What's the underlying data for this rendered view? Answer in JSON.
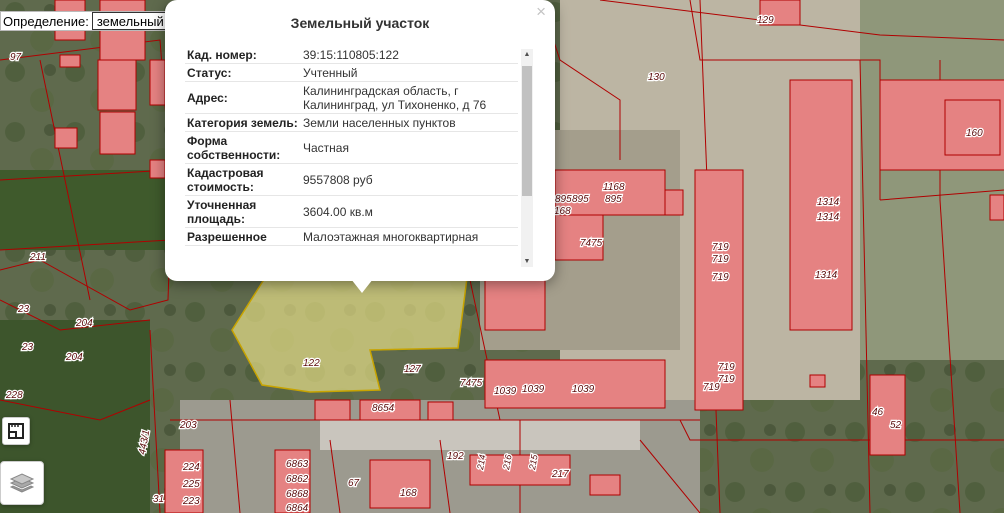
{
  "definition": {
    "label": "Определение:",
    "selected": "земельный участок"
  },
  "popup": {
    "title": "Земельный участок",
    "close": "×",
    "fields": [
      {
        "key": "Кад. номер:",
        "value": "39:15:110805:122"
      },
      {
        "key": "Статус:",
        "value": "Учтенный"
      },
      {
        "key": "Адрес:",
        "value": "Калининградская область, г Калининград, ул Тихоненко, д 76"
      },
      {
        "key": "Категория земель:",
        "value": "Земли населенных пунктов"
      },
      {
        "key": "Форма собственности:",
        "value": "Частная"
      },
      {
        "key": "Кадастровая стоимость:",
        "value": "9557808 руб"
      },
      {
        "key": "Уточненная площадь:",
        "value": "3604.00 кв.м"
      },
      {
        "key": "Разрешенное",
        "value": "Малоэтажная многоквартирная"
      }
    ]
  },
  "map_labels": {
    "l97": "97",
    "l129": "129",
    "l130": "130",
    "l160": "160",
    "l1168": "1168",
    "l895": "895",
    "l895b": "895",
    "l895c": "895",
    "l168": "168",
    "l7475": "7475",
    "l7475b": "7475",
    "l719a": "719",
    "l719b": "719",
    "l719c": "719",
    "l719d": "719",
    "l719e": "719",
    "l719f": "719",
    "l1314a": "1314",
    "l1314b": "1314",
    "l1314c": "1314",
    "l211": "211",
    "l23a": "23",
    "l23b": "23",
    "l204a": "204",
    "l204b": "204",
    "l228": "228",
    "l122": "122",
    "l127": "127",
    "l1039a": "1039",
    "l1039b": "1039",
    "l1039c": "1039",
    "l8654": "8654",
    "l46": "46",
    "l52": "52",
    "l203": "203",
    "l4431": "443/1",
    "l224": "224",
    "l225": "225",
    "l223": "223",
    "l31": "31",
    "l6863": "6863",
    "l6862": "6862",
    "l6868": "6868",
    "l6864": "6864",
    "l67": "67",
    "l168b": "168",
    "l192": "192",
    "l214": "214",
    "l216": "216",
    "l215": "215",
    "l217": "217"
  },
  "icons": {
    "layers": "layers-icon",
    "measure": "ruler-icon"
  },
  "colors": {
    "parcel_fill": "#e58282",
    "parcel_stroke": "#b00000",
    "selected_fill": "#f0e68c",
    "selected_stroke": "#c8a400"
  }
}
